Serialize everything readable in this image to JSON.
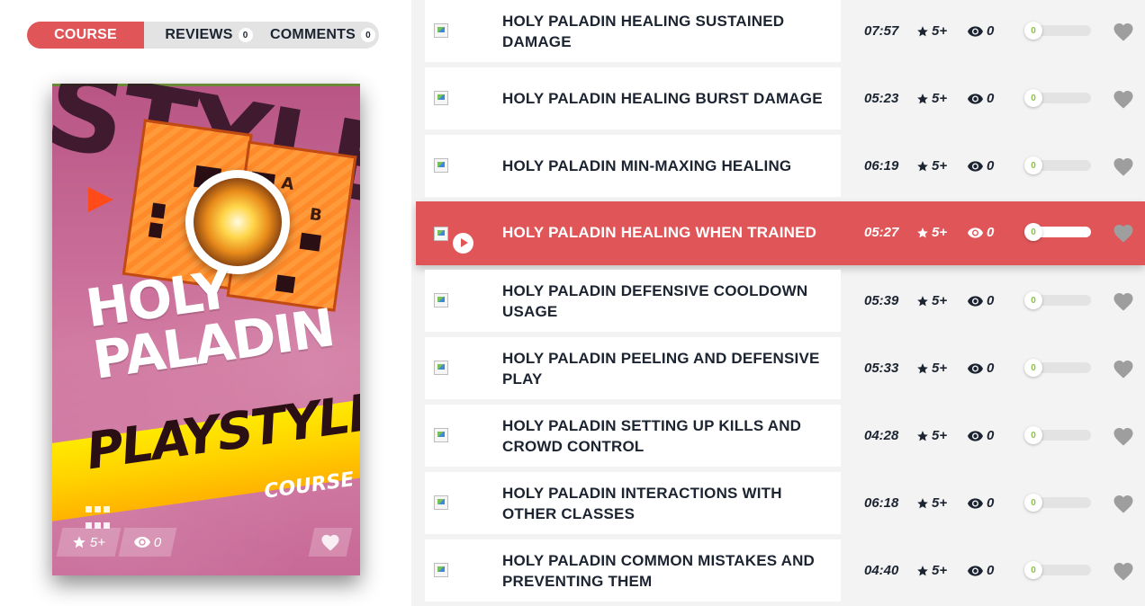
{
  "tabs": [
    {
      "label": "COURSE",
      "active": true
    },
    {
      "label": "REVIEWS",
      "count": "0"
    },
    {
      "label": "COMMENTS",
      "count": "0"
    }
  ],
  "card": {
    "title_line1": "HOLY",
    "title_line2": "PALADIN",
    "band_text": "PLAYSTYLE",
    "subtitle": "COURSE",
    "bg_word": "STYLE",
    "letter_a": "A",
    "letter_b": "B",
    "rating": "5+",
    "views": "0",
    "icons": {
      "star": "star-icon",
      "eye": "eye-icon",
      "heart": "heart-icon"
    }
  },
  "lessons": [
    {
      "title": "HOLY PALADIN HEALING SUSTAINED DAMAGE",
      "duration": "07:57",
      "rating": "5+",
      "views": "0",
      "progress": "0",
      "active": false
    },
    {
      "title": "HOLY PALADIN HEALING BURST DAMAGE",
      "duration": "05:23",
      "rating": "5+",
      "views": "0",
      "progress": "0",
      "active": false
    },
    {
      "title": "HOLY PALADIN MIN-MAXING HEALING",
      "duration": "06:19",
      "rating": "5+",
      "views": "0",
      "progress": "0",
      "active": false
    },
    {
      "title": "HOLY PALADIN HEALING WHEN TRAINED",
      "duration": "05:27",
      "rating": "5+",
      "views": "0",
      "progress": "0",
      "active": true
    },
    {
      "title": "HOLY PALADIN DEFENSIVE COOLDOWN USAGE",
      "duration": "05:39",
      "rating": "5+",
      "views": "0",
      "progress": "0",
      "active": false
    },
    {
      "title": "HOLY PALADIN PEELING AND DEFENSIVE PLAY",
      "duration": "05:33",
      "rating": "5+",
      "views": "0",
      "progress": "0",
      "active": false
    },
    {
      "title": "HOLY PALADIN SETTING UP KILLS AND CROWD CONTROL",
      "duration": "04:28",
      "rating": "5+",
      "views": "0",
      "progress": "0",
      "active": false
    },
    {
      "title": "HOLY PALADIN INTERACTIONS WITH OTHER CLASSES",
      "duration": "06:18",
      "rating": "5+",
      "views": "0",
      "progress": "0",
      "active": false
    },
    {
      "title": "HOLY PALADIN COMMON MISTAKES AND PREVENTING THEM",
      "duration": "04:40",
      "rating": "5+",
      "views": "0",
      "progress": "0",
      "active": false
    }
  ],
  "colors": {
    "accent": "#e05658",
    "text": "#1c2431",
    "progress": "#8bc34a",
    "heart": "#9e9e9e"
  }
}
